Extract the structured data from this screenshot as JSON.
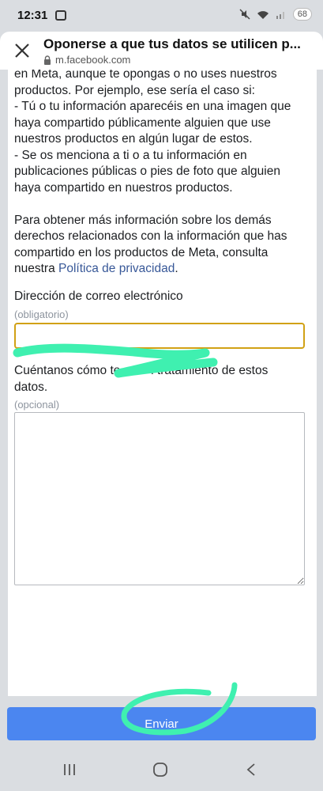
{
  "status_bar": {
    "time": "12:31",
    "battery": "68"
  },
  "header": {
    "title": "Oponerse a que tus datos se utilicen p...",
    "url": "m.facebook.com"
  },
  "content": {
    "lines": [
      "en Meta, aunque te opongas o no uses nuestros",
      "productos. Por ejemplo, ese sería el caso si:",
      "- Tú o tu información aparecéis en una imagen que",
      "haya compartido públicamente alguien que use",
      "nuestros productos en algún lugar de estos.",
      "- Se os menciona a ti o a tu información en",
      "publicaciones públicas o pies de foto que alguien",
      "haya compartido en nuestros productos."
    ],
    "more_info_lines": [
      "Para obtener más información sobre los demás",
      "derechos relacionados con la información que has",
      "compartido en los productos de Meta, consulta"
    ],
    "more_info_prefix": "nuestra",
    "privacy_link": "Política de privacidad",
    "privacy_suffix": "."
  },
  "form": {
    "email_label": "Dirección de correo electrónico",
    "email_hint": "(obligatorio)",
    "email_value": "",
    "reason_label_line1": "Cuéntanos cómo te         l tratamiento de estos",
    "reason_label_line2": "datos.",
    "reason_hint": "(opcional)",
    "reason_value": "",
    "submit_label": "Enviar"
  },
  "colors": {
    "focus_border": "#d1a115",
    "submit_bg": "#4b86f0",
    "link": "#385898",
    "highlight": "#3ff0b0"
  },
  "icons": {
    "close": "close-icon",
    "lock": "lock-icon",
    "nav_recents": "recents-icon",
    "nav_home": "home-icon",
    "nav_back": "back-icon"
  }
}
